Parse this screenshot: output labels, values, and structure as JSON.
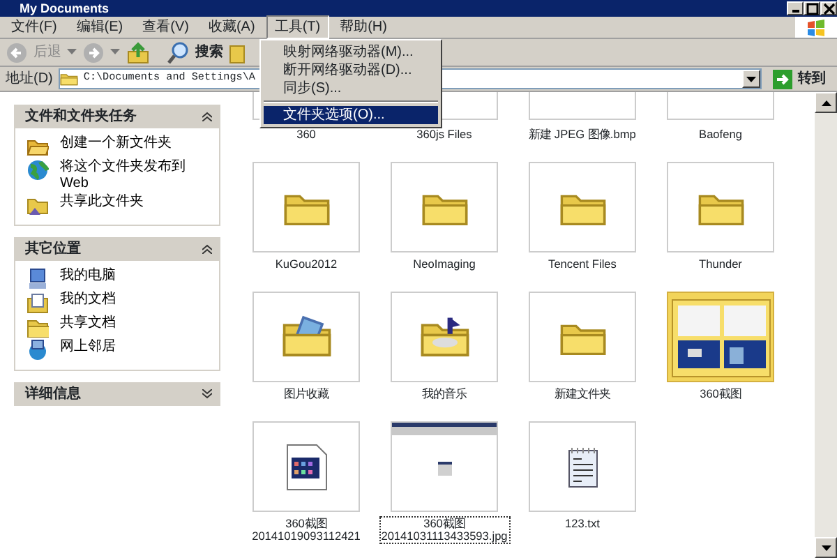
{
  "window": {
    "title": "My Documents"
  },
  "menu": [
    {
      "label": "文件(F)",
      "open": false
    },
    {
      "label": "编辑(E)",
      "open": false
    },
    {
      "label": "查看(V)",
      "open": false
    },
    {
      "label": "收藏(A)",
      "open": false
    },
    {
      "label": "工具(T)",
      "open": true
    },
    {
      "label": "帮助(H)",
      "open": false
    }
  ],
  "menu_dropdown": [
    {
      "kind": "item",
      "label": "映射网络驱动器(M)...",
      "highlighted": false
    },
    {
      "kind": "item",
      "label": "断开网络驱动器(D)...",
      "highlighted": false
    },
    {
      "kind": "item",
      "label": "同步(S)...",
      "highlighted": false
    },
    {
      "kind": "separator"
    },
    {
      "kind": "item",
      "label": "文件夹选项(O)...",
      "highlighted": true
    }
  ],
  "toolbar": {
    "back": {
      "label": "后退",
      "disabled": true
    },
    "search": {
      "label": "搜索"
    }
  },
  "address": {
    "label": "地址(D)",
    "path": "C:\\Documents and Settings\\A",
    "go": "转到"
  },
  "task_panels": [
    {
      "title": "文件和文件夹任务",
      "expanded": true,
      "items": [
        {
          "kind": "new-folder",
          "label": "创建一个新文件夹"
        },
        {
          "kind": "globe",
          "label": "将这个文件夹发布到 Web"
        },
        {
          "kind": "share",
          "label": "共享此文件夹"
        }
      ]
    },
    {
      "title": "其它位置",
      "expanded": true,
      "items": [
        {
          "kind": "computer",
          "label": "我的电脑"
        },
        {
          "kind": "documents",
          "label": "我的文档"
        },
        {
          "kind": "folder",
          "label": "共享文档"
        },
        {
          "kind": "network",
          "label": "网上邻居"
        }
      ]
    },
    {
      "title": "详细信息",
      "expanded": false
    }
  ],
  "files": [
    {
      "kind": "cut",
      "name": "360",
      "focused": false
    },
    {
      "kind": "cut",
      "name": "360js Files",
      "focused": false
    },
    {
      "kind": "cut",
      "name": "新建 JPEG 图像.bmp",
      "focused": false
    },
    {
      "kind": "cut",
      "name": "Baofeng",
      "focused": false
    },
    {
      "kind": "folder",
      "name": "KuGou2012",
      "focused": false
    },
    {
      "kind": "folder",
      "name": "NeoImaging",
      "focused": false
    },
    {
      "kind": "folder",
      "name": "Tencent Files",
      "focused": false
    },
    {
      "kind": "folder",
      "name": "Thunder",
      "focused": false
    },
    {
      "kind": "picture-folder",
      "name": "图片收藏",
      "focused": false
    },
    {
      "kind": "music-folder",
      "name": "我的音乐",
      "focused": false
    },
    {
      "kind": "folder",
      "name": "新建文件夹",
      "focused": false
    },
    {
      "kind": "preview-folder",
      "name": "360截图",
      "focused": false
    },
    {
      "kind": "image-file",
      "name": "360截图 20141019093112421",
      "focused": false
    },
    {
      "kind": "screenshot",
      "name": "360截图 20141031113433593.jpg",
      "focused": true
    },
    {
      "kind": "text-file",
      "name": "123.txt",
      "focused": false
    }
  ]
}
